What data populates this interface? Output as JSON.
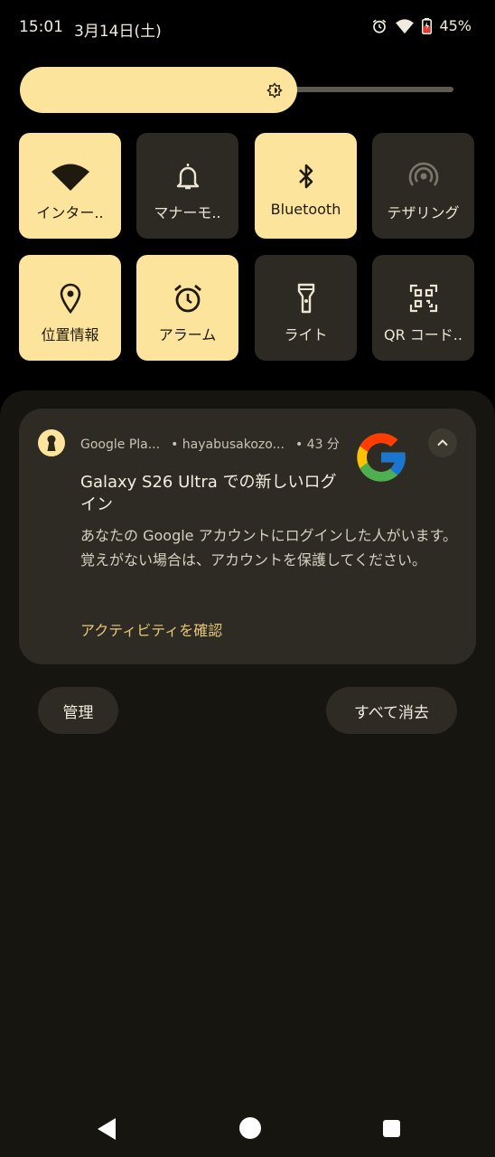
{
  "status_bar": {
    "time": "15:01",
    "date": "3月14日(土)",
    "battery": "45%",
    "icons": [
      "alarm-icon",
      "wifi-icon",
      "battery-charging-icon"
    ]
  },
  "brightness": {
    "level": 0.64,
    "icon": "brightness-icon"
  },
  "tiles": [
    {
      "label": "インター..",
      "icon": "wifi-icon",
      "active": true
    },
    {
      "label": "マナーモ..",
      "icon": "bell-icon",
      "active": false
    },
    {
      "label": "Bluetooth",
      "icon": "bluetooth-icon",
      "active": true
    },
    {
      "label": "テザリング",
      "icon": "hotspot-icon",
      "active": false
    },
    {
      "label": "位置情報",
      "icon": "location-icon",
      "active": true
    },
    {
      "label": "アラーム",
      "icon": "alarm-icon",
      "active": true
    },
    {
      "label": "ライト",
      "icon": "flashlight-icon",
      "active": false
    },
    {
      "label": "QR コード..",
      "icon": "qr-code-icon",
      "active": false
    }
  ],
  "notification": {
    "app_name": "Google Pla...",
    "account": "• hayabusakozo...",
    "time_ago": "• 43 分",
    "title": "Galaxy S26 Ultra での新しいログイン",
    "body": "あなたの Google アカウントにログインした人がいます。覚えがない場合は、アカウントを保護してください。",
    "action": "アクティビティを確認",
    "colors": {
      "accent": "#fde49c",
      "action": "#e9c977"
    }
  },
  "footer": {
    "manage": "管理",
    "clear_all": "すべて消去"
  },
  "colors": {
    "tile_on": "#fde49c",
    "tile_off": "#2d2a23",
    "shade": "#171510",
    "card": "#2e2b24"
  }
}
